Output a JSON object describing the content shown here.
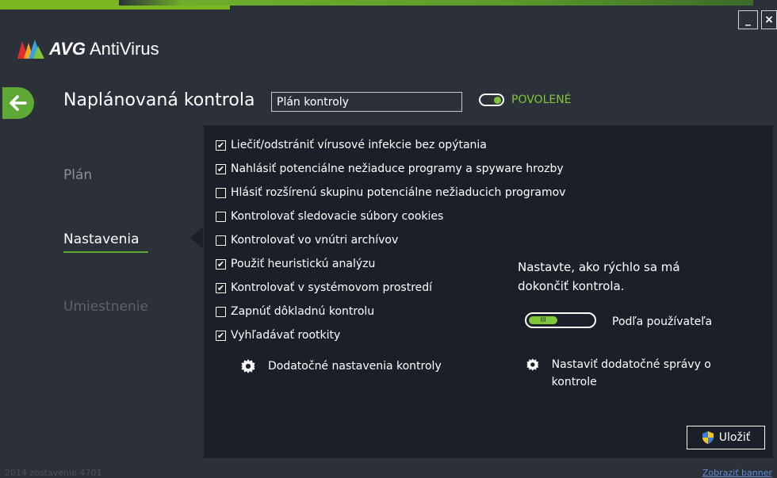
{
  "window": {
    "app_name_brand": "AVG",
    "app_name_product": "AntiVirus",
    "minimize_label": "_",
    "close_label": "×"
  },
  "header": {
    "title": "Naplánovaná kontrola",
    "scan_name": "Plán kontroly",
    "status_label": "POVOLENÉ",
    "status_enabled": true
  },
  "nav": {
    "items": [
      {
        "label": "Plán",
        "active": false
      },
      {
        "label": "Nastavenia",
        "active": true
      },
      {
        "label": "Umiestnenie",
        "active": false
      }
    ]
  },
  "settings": {
    "options": [
      {
        "label": "Liečiť/odstrániť vírusové infekcie bez opýtania",
        "checked": true
      },
      {
        "label": "Nahlásiť potenciálne nežiaduce programy a spyware hrozby",
        "checked": true
      },
      {
        "label": "Hlásiť rozšírenú skupinu potenciálne nežiaducich programov",
        "checked": false
      },
      {
        "label": "Kontrolovať sledovacie súbory cookies",
        "checked": false
      },
      {
        "label": "Kontrolovať vo vnútri archívov",
        "checked": false
      },
      {
        "label": "Použiť heuristickú analýzu",
        "checked": true
      },
      {
        "label": "Kontrolovať v systémovom prostredí",
        "checked": true
      },
      {
        "label": "Zapnúť dôkladnú kontrolu",
        "checked": false
      },
      {
        "label": "Vyhľadávať rootkity",
        "checked": true
      }
    ],
    "speed_text": "Nastavte, ako rýchlo sa má dokončiť kontrola.",
    "speed_value_label": "Podľa používateľa",
    "speed_fill_fraction": 0.45,
    "extra_settings_link": "Dodatočné nastavenia kontroly",
    "reports_link": "Nastaviť dodatočné správy o kontrole",
    "save_label": "Uložiť"
  },
  "footer": {
    "build": "2014 zostavenie 4701",
    "banner_link": "Zobraziť banner"
  },
  "colors": {
    "accent": "#7fc639",
    "background": "#2c3139",
    "panel": "#1b2028"
  }
}
